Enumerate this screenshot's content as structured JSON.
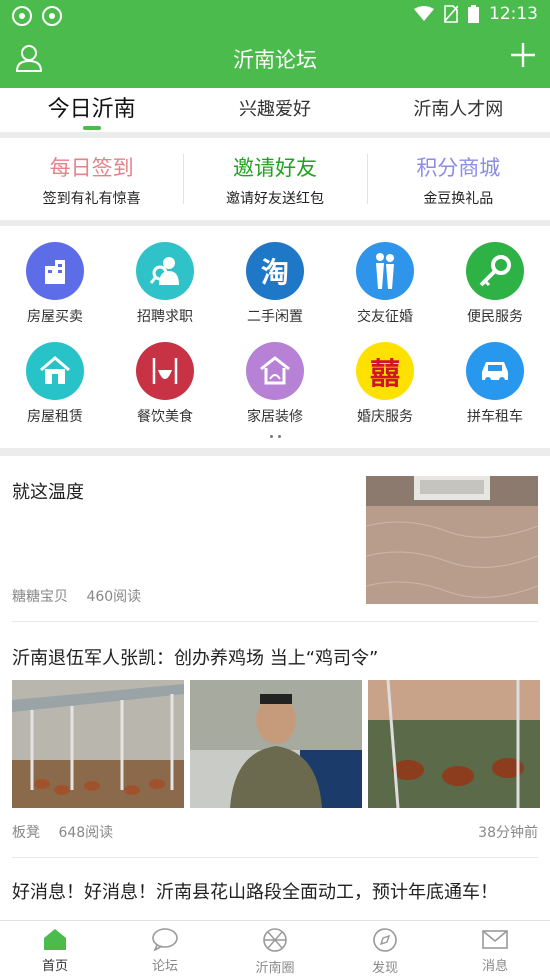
{
  "status_bar": {
    "time": "12:13"
  },
  "header": {
    "title": "沂南论坛"
  },
  "tabs": [
    {
      "label": "今日沂南"
    },
    {
      "label": "兴趣爱好"
    },
    {
      "label": "沂南人才网"
    }
  ],
  "promo": [
    {
      "title": "每日签到",
      "subtitle": "签到有礼有惊喜",
      "color": "#e5818a"
    },
    {
      "title": "邀请好友",
      "subtitle": "邀请好友送红包",
      "color": "#21a321"
    },
    {
      "title": "积分商城",
      "subtitle": "金豆换礼品",
      "color": "#8a8ce8"
    }
  ],
  "services": [
    {
      "label": "房屋买卖",
      "icon": "building-icon",
      "color": "#5d6de8"
    },
    {
      "label": "招聘求职",
      "icon": "job-search-icon",
      "color": "#2fc3c9"
    },
    {
      "label": "二手闲置",
      "icon": "taobao-icon",
      "color": "#1f77c8"
    },
    {
      "label": "交友征婚",
      "icon": "couple-icon",
      "color": "#2f95ea"
    },
    {
      "label": "便民服务",
      "icon": "key-icon",
      "color": "#2eb245"
    },
    {
      "label": "房屋租赁",
      "icon": "house-icon",
      "color": "#27c3c9"
    },
    {
      "label": "餐饮美食",
      "icon": "dining-icon",
      "color": "#c83245"
    },
    {
      "label": "家居装修",
      "icon": "home-decor-icon",
      "color": "#b781d6"
    },
    {
      "label": "婚庆服务",
      "icon": "double-happiness-icon",
      "color": "#ffe100"
    },
    {
      "label": "拼车租车",
      "icon": "carpool-icon",
      "color": "#2898ee"
    }
  ],
  "posts": [
    {
      "title": "就这温度",
      "author": "糖糖宝贝",
      "reads": "460阅读"
    },
    {
      "title": "沂南退伍军人张凯：创办养鸡场 当上“鸡司令”",
      "author": "板凳",
      "reads": "648阅读",
      "time": "38分钟前"
    },
    {
      "title": "好消息！好消息！沂南县花山路段全面动工，预计年底通车！"
    }
  ],
  "bottom_nav": [
    {
      "label": "首页",
      "icon": "home-icon"
    },
    {
      "label": "论坛",
      "icon": "chat-bubble-icon"
    },
    {
      "label": "沂南圈",
      "icon": "aperture-icon"
    },
    {
      "label": "发现",
      "icon": "compass-icon"
    },
    {
      "label": "消息",
      "icon": "mail-icon"
    }
  ],
  "colors": {
    "accent": "#4cbb4d"
  }
}
